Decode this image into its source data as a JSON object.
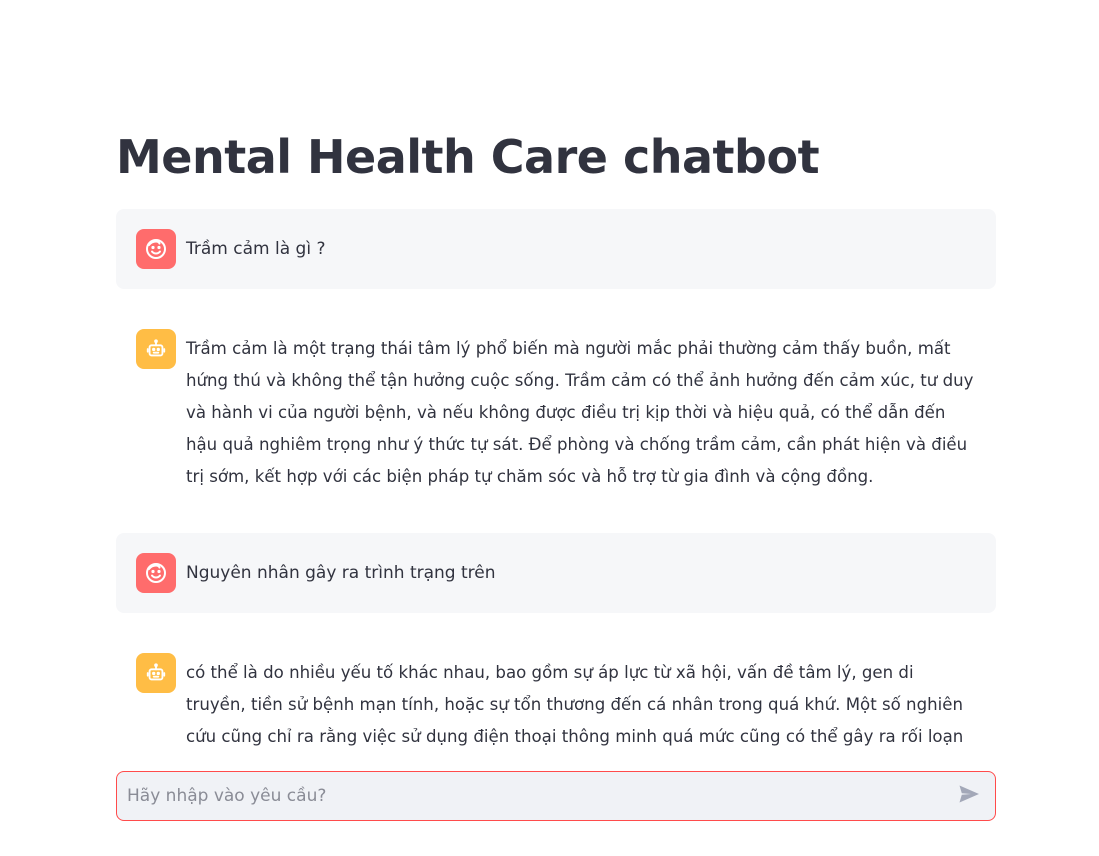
{
  "page": {
    "title": "Mental Health Care chatbot"
  },
  "messages": [
    {
      "role": "user",
      "avatar_icon": "smiley-face-icon",
      "text": "Trầm cảm là gì ?"
    },
    {
      "role": "assistant",
      "avatar_icon": "robot-icon",
      "text": "Trầm cảm là một trạng thái tâm lý phổ biến mà người mắc phải thường cảm thấy buồn, mất hứng thú và không thể tận hưởng cuộc sống. Trầm cảm có thể ảnh hưởng đến cảm xúc, tư duy và hành vi của người bệnh, và nếu không được điều trị kịp thời và hiệu quả, có thể dẫn đến hậu quả nghiêm trọng như ý thức tự sát. Để phòng và chống trầm cảm, cần phát hiện và điều trị sớm, kết hợp với các biện pháp tự chăm sóc và hỗ trợ từ gia đình và cộng đồng."
    },
    {
      "role": "user",
      "avatar_icon": "smiley-face-icon",
      "text": "Nguyên nhân gây ra trình trạng trên"
    },
    {
      "role": "assistant",
      "avatar_icon": "robot-icon",
      "text": "có thể là do nhiều yếu tố khác nhau, bao gồm sự áp lực từ xã hội, vấn đề tâm lý, gen di truyền, tiền sử bệnh mạn tính, hoặc sự tổn thương đến cá nhân trong quá khứ. Một số nghiên cứu cũng chỉ ra rằng việc sử dụng điện thoại thông minh quá mức cũng có thể gây ra rối loạn giấc ngủ và ảnh"
    }
  ],
  "chat_input": {
    "placeholder": "Hãy nhập vào yêu cầu?",
    "value": "",
    "send_icon": "send-icon"
  },
  "colors": {
    "user_avatar": "#ff6c6c",
    "bot_avatar": "#ffbd45",
    "user_bubble": "#f6f7f9",
    "input_border": "#ff4b4b",
    "input_bg": "#f0f2f6"
  }
}
